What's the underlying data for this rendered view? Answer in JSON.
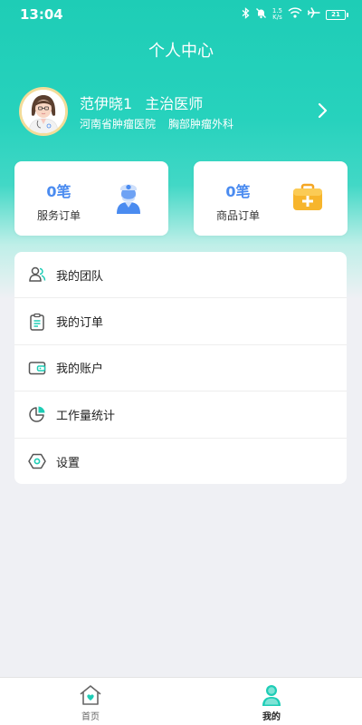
{
  "status_bar": {
    "time": "13:04",
    "net_rate_value": "1.5",
    "net_rate_unit": "K/s",
    "battery": "21",
    "icons": [
      "bluetooth-icon",
      "mute-bell-icon",
      "wifi-icon",
      "airplane-icon",
      "battery-icon"
    ]
  },
  "header": {
    "title": "个人中心"
  },
  "profile": {
    "name": "范伊晓1",
    "title": "主治医师",
    "hospital": "河南省肿瘤医院",
    "department": "胸部肿瘤外科"
  },
  "cards": [
    {
      "count": "0笔",
      "label": "服务订单",
      "icon": "doctor-icon"
    },
    {
      "count": "0笔",
      "label": "商品订单",
      "icon": "medical-kit-icon"
    }
  ],
  "menu": [
    {
      "label": "我的团队",
      "icon": "team-icon"
    },
    {
      "label": "我的订单",
      "icon": "order-list-icon"
    },
    {
      "label": "我的账户",
      "icon": "wallet-icon"
    },
    {
      "label": "工作量统计",
      "icon": "pie-chart-icon"
    },
    {
      "label": "设置",
      "icon": "settings-icon"
    }
  ],
  "bottom_nav": {
    "items": [
      {
        "label": "首页",
        "icon": "home-heart-icon",
        "active": false
      },
      {
        "label": "我的",
        "icon": "person-icon",
        "active": true
      }
    ]
  },
  "colors": {
    "accent": "#1ecdb6",
    "count_blue": "#4a8bf0",
    "kit_orange": "#f7b52c"
  }
}
